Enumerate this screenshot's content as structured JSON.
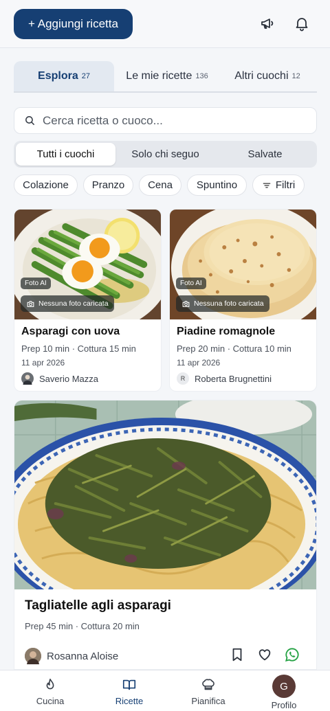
{
  "header": {
    "add_button_label": "+ Aggiungi ricetta",
    "icons": [
      "megaphone-icon",
      "bell-icon"
    ]
  },
  "tabs": [
    {
      "label": "Esplora",
      "count": "27",
      "active": true
    },
    {
      "label": "Le mie ricette",
      "count": "136",
      "active": false
    },
    {
      "label": "Altri cuochi",
      "count": "12",
      "active": false
    }
  ],
  "search": {
    "placeholder": "Cerca ricetta o cuoco...",
    "value": ""
  },
  "filter_segment": {
    "items": [
      "Tutti i cuochi",
      "Solo chi seguo",
      "Salvate"
    ],
    "selected": "Tutti i cuochi"
  },
  "chips": {
    "items": [
      "Colazione",
      "Pranzo",
      "Cena",
      "Spuntino"
    ],
    "filters_label": "Filtri"
  },
  "recipes": [
    {
      "title": "Asparagi con uova",
      "meta": "Prep 10 min · Cottura 15 min",
      "date": "11 apr 2026",
      "author": "Saverio Mazza",
      "badge_ai": "Foto AI",
      "badge_nophoto": "Nessuna foto caricata"
    },
    {
      "title": "Piadine romagnole",
      "meta": "Prep 20 min · Cottura 10 min",
      "date": "11 apr 2026",
      "author": "Roberta Brugnettini",
      "author_initial": "R",
      "badge_ai": "Foto AI",
      "badge_nophoto": "Nessuna foto caricata"
    },
    {
      "title": "Tagliatelle agli asparagi",
      "meta": "Prep 45 min · Cottura 20 min",
      "author": "Rosanna Aloise",
      "actions": [
        "bookmark-icon",
        "heart-icon",
        "whatsapp-icon"
      ]
    }
  ],
  "bottom_nav": [
    {
      "label": "Cucina",
      "icon": "flame-icon",
      "active": false
    },
    {
      "label": "Ricette",
      "icon": "book-icon",
      "active": true
    },
    {
      "label": "Pianifica",
      "icon": "chef-hat-icon",
      "active": false
    },
    {
      "label": "Profilo",
      "icon": "profile-avatar",
      "initial": "G",
      "active": false
    }
  ],
  "colors": {
    "brand": "#163f73",
    "whatsapp": "#25a244",
    "background": "#f4f6f9"
  }
}
